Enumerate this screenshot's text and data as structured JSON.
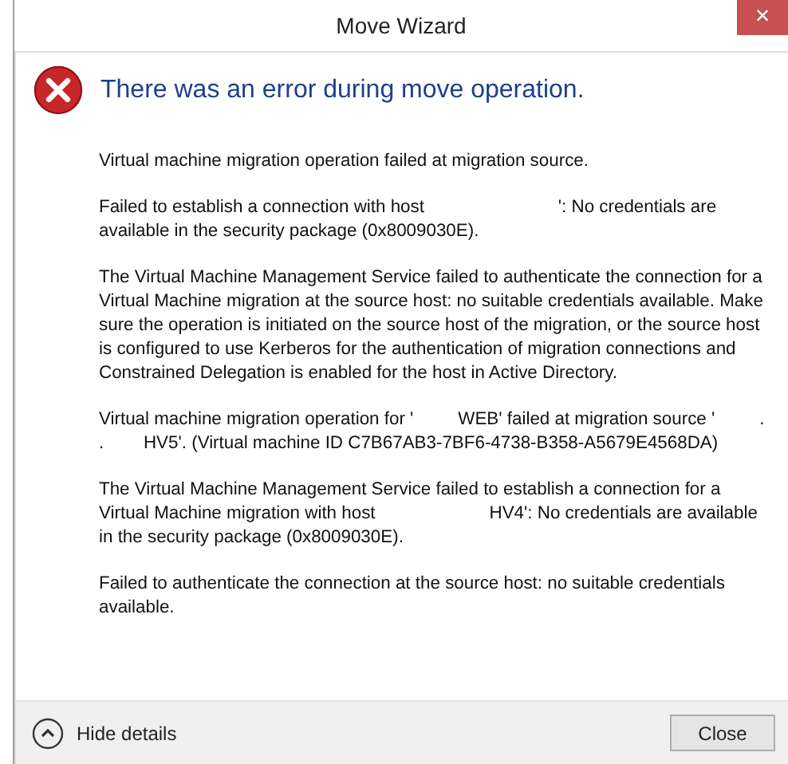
{
  "window": {
    "title": "Move Wizard",
    "close": "×"
  },
  "heading": "There was an error during move operation.",
  "paragraphs": [
    "Virtual machine migration operation failed at migration source.",
    "Failed to establish a connection with host                           ': No credentials are available in the security package (0x8009030E).",
    "The Virtual Machine Management Service failed to authenticate the connection for a Virtual Machine migration at the source host: no suitable credentials available. Make sure the operation is initiated on the source host of the migration, or the source host is configured to use Kerberos for the authentication of migration connections and Constrained Delegation is enabled for the host in Active Directory.",
    "Virtual machine migration operation for '         WEB' failed at migration source '         .  .        HV5'. (Virtual machine ID C7B67AB3-7BF6-4738-B358-A5679E4568DA)",
    "The Virtual Machine Management Service failed to establish a connection for a Virtual Machine migration with host                       HV4': No credentials are available in the security package (0x8009030E).",
    "Failed to authenticate the connection at the source host: no suitable credentials available."
  ],
  "details_toggle": {
    "label": "Hide details",
    "expanded": true
  },
  "buttons": [
    "Close"
  ]
}
